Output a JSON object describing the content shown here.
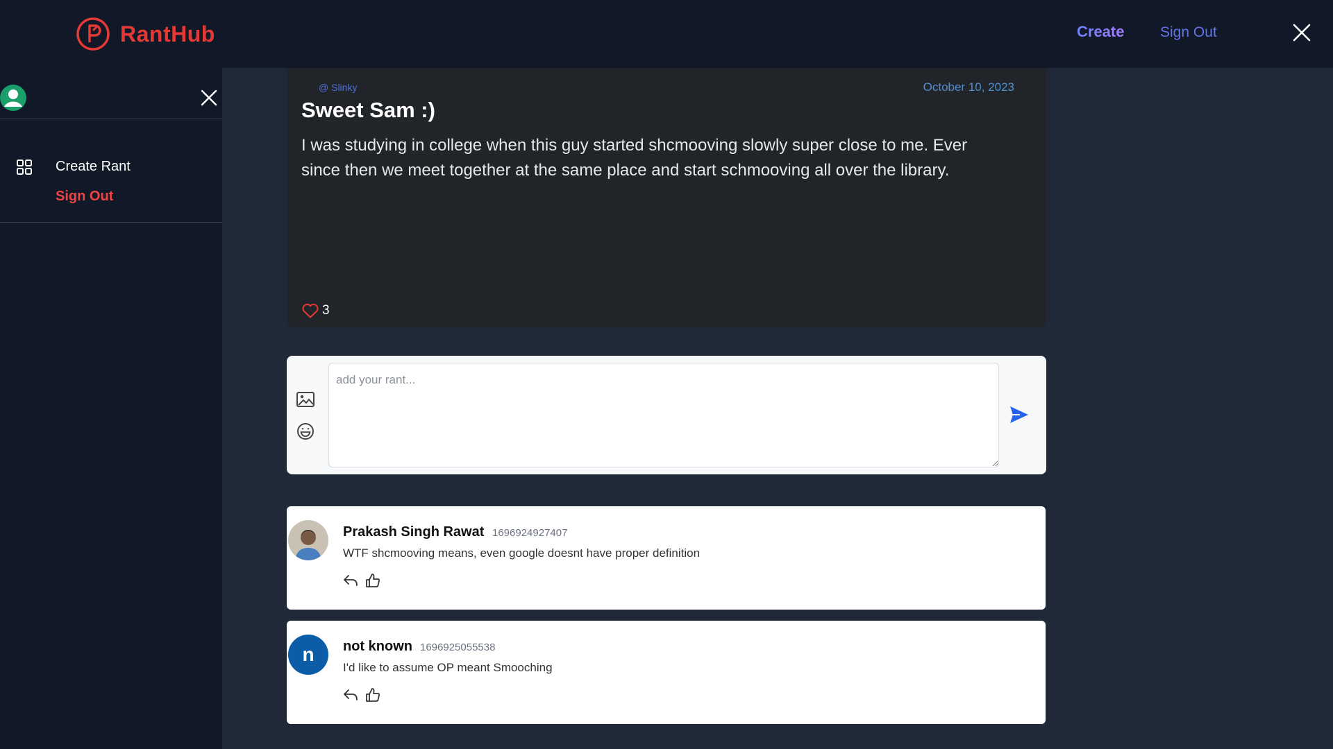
{
  "app": {
    "name": "RantHub",
    "brand_color": "#e53935"
  },
  "topnav": {
    "create_label": "Create",
    "signout_label": "Sign Out"
  },
  "sidebar": {
    "items": [
      {
        "label": "Create Rant",
        "icon": "grid-icon"
      },
      {
        "label": "Sign Out"
      }
    ]
  },
  "post": {
    "author": "@ Slinky",
    "date": "October 10, 2023",
    "title": "Sweet Sam :)",
    "body": "I was studying in college when this guy started shcmooving slowly super close to me. Ever since then we meet together at the same place and start schmooving all over the library.",
    "likes": "3"
  },
  "composer": {
    "placeholder": "add your rant..."
  },
  "comments": [
    {
      "name": "Prakash Singh Rawat",
      "timestamp": "1696924927407",
      "text": "WTF shcmooving means, even google doesnt have proper definition",
      "avatar": "photo"
    },
    {
      "name": "not known",
      "timestamp": "1696925055538",
      "text": "I'd like to assume OP meant Smooching",
      "avatar_letter": "n"
    }
  ]
}
